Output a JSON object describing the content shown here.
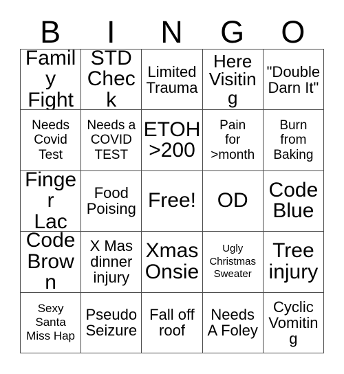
{
  "card": {
    "title": "Bingo Card",
    "header_letters": [
      "B",
      "I",
      "N",
      "G",
      "O"
    ],
    "colors": {
      "background": "#ffffff",
      "text": "#000000",
      "grid_line": "#4d4d4d"
    },
    "grid": {
      "columns": 5,
      "rows": 5,
      "free_space": "Free!",
      "free_space_index": 12
    },
    "cells": [
      {
        "text": "Family\nFight",
        "size": "xl"
      },
      {
        "text": "STD\nCheck",
        "size": "xl"
      },
      {
        "text": "Limited\nTrauma",
        "size": "md"
      },
      {
        "text": "Here\nVisiting",
        "size": "lg"
      },
      {
        "text": "\"Double\nDarn It\"",
        "size": "md"
      },
      {
        "text": "Needs\nCovid\nTest",
        "size": "sm"
      },
      {
        "text": "Needs a\nCOVID\nTEST",
        "size": "sm"
      },
      {
        "text": "ETOH\n>200",
        "size": "xl"
      },
      {
        "text": "Pain\nfor\n>month",
        "size": "sm"
      },
      {
        "text": "Burn\nfrom\nBaking",
        "size": "sm"
      },
      {
        "text": "Finger\nLac",
        "size": "xl"
      },
      {
        "text": "Food\nPoising",
        "size": "md"
      },
      {
        "text": "Free!",
        "size": "xl"
      },
      {
        "text": "OD",
        "size": "xl"
      },
      {
        "text": "Code\nBlue",
        "size": "xl"
      },
      {
        "text": "Code\nBrown",
        "size": "xl"
      },
      {
        "text": "X Mas\ndinner\ninjury",
        "size": "md"
      },
      {
        "text": "Xmas\nOnsie",
        "size": "xl"
      },
      {
        "text": "Ugly\nChristmas\nSweater",
        "size": "xxs"
      },
      {
        "text": "Tree\ninjury",
        "size": "xl"
      },
      {
        "text": "Sexy\nSanta\nMiss Hap",
        "size": "xs"
      },
      {
        "text": "Pseudo\nSeizure",
        "size": "md"
      },
      {
        "text": "Fall off\nroof",
        "size": "md"
      },
      {
        "text": "Needs\nA Foley",
        "size": "md"
      },
      {
        "text": "Cyclic\nVomiting",
        "size": "md"
      }
    ]
  }
}
